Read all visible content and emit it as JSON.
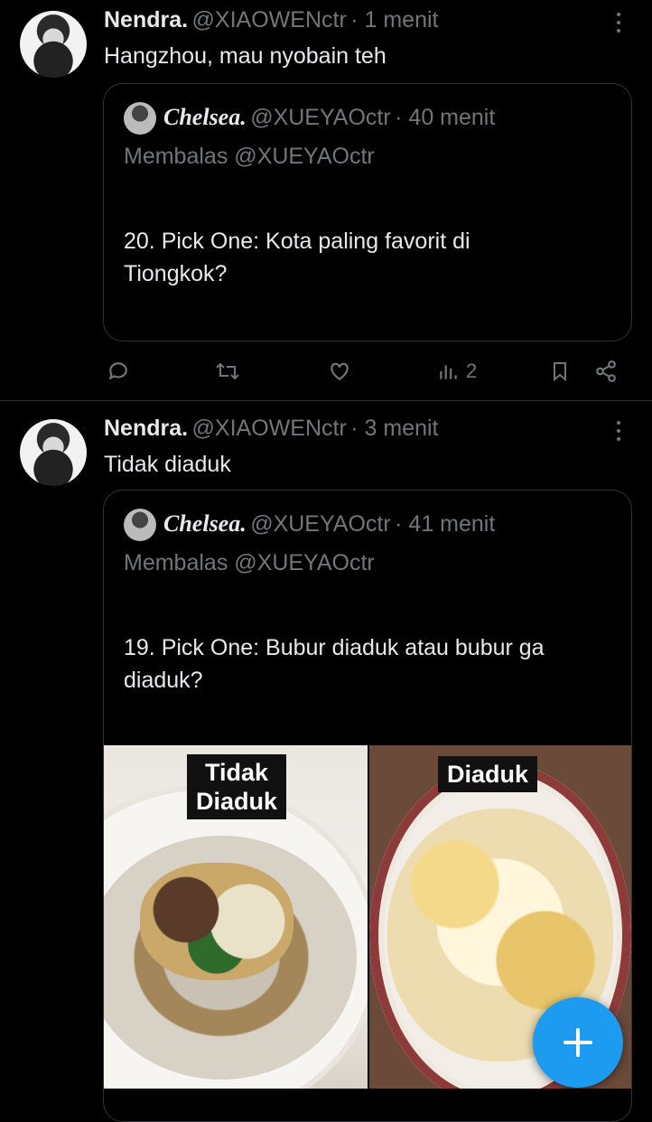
{
  "posts": [
    {
      "name": "Nendra.",
      "handle": "@XIAOWENctr",
      "time": "· 1 menit",
      "text": "Hangzhou, mau nyobain teh",
      "quote": {
        "name": "Chelsea.",
        "handle": "@XUEYAOctr",
        "time": "· 40 menit",
        "reply_to": "Membalas @XUEYAOctr",
        "text_line1": "20. Pick One: Kota paling favorit di",
        "text_line2": "Tiongkok?"
      },
      "views": "2"
    },
    {
      "name": "Nendra.",
      "handle": "@XIAOWENctr",
      "time": "· 3 menit",
      "text": "Tidak diaduk",
      "quote": {
        "name": "Chelsea.",
        "handle": "@XUEYAOctr",
        "time": "· 41 menit",
        "reply_to": "Membalas @XUEYAOctr",
        "text_line1": "19. Pick One: Bubur diaduk atau bubur ga",
        "text_line2": "diaduk?",
        "image_left_label_line1": "Tidak",
        "image_left_label_line2": "Diaduk",
        "image_right_label": "Diaduk"
      }
    }
  ],
  "icons": {
    "reply": "reply-icon",
    "retweet": "retweet-icon",
    "like": "like-icon",
    "views": "views-icon",
    "bookmark": "bookmark-icon",
    "share": "share-icon",
    "compose": "plus-icon"
  },
  "colors": {
    "background": "#000000",
    "accent": "#1d9bf0",
    "muted": "#71767b",
    "divider": "#2f3336"
  }
}
